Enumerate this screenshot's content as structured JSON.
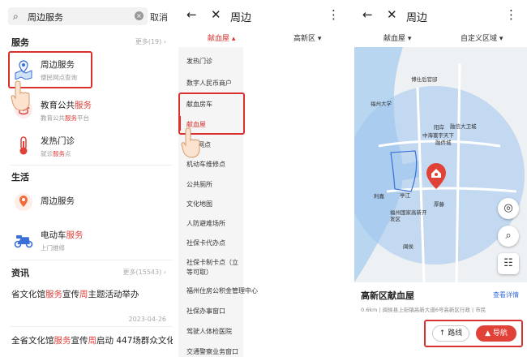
{
  "panel1": {
    "search_value": "周边服务",
    "clear_icon": "clear-icon",
    "cancel_label": "取消",
    "services_section": {
      "title": "服务",
      "more": "更多(19)"
    },
    "services": [
      {
        "title": "周边服务",
        "sub": "便民网点查询",
        "icon": "map-pin-icon"
      },
      {
        "title_plain": "教育公共",
        "title_hl": "服务",
        "sub_plain": "教育公共",
        "sub_hl": "服务",
        "sub_tail": "平台",
        "icon": "education-icon"
      },
      {
        "title": "发热门诊",
        "sub_plain": "就诊",
        "sub_hl": "服务",
        "sub_tail": "点",
        "icon": "thermometer-icon"
      }
    ],
    "life_section": {
      "title": "生活"
    },
    "life": [
      {
        "title": "周边服务",
        "icon": "map-pin-icon"
      },
      {
        "title_plain": "电动车",
        "title_hl": "服务",
        "sub": "上门维修",
        "icon": "scooter-icon"
      }
    ],
    "news_section": {
      "title": "资讯",
      "more": "更多(15543)"
    },
    "news": [
      {
        "a": "省文化馆",
        "b": "服务",
        "c": "宣传",
        "d": "周",
        "e": "主题活动举办",
        "date": "2023-04-26"
      },
      {
        "a": "全省文化馆",
        "b": "服务",
        "c": "宣传",
        "d": "周",
        "e": "启动 447场群众文化"
      }
    ]
  },
  "panel2": {
    "title": "周边",
    "filter_left": "献血屋",
    "filter_right": "高新区",
    "menu": [
      "发热门诊",
      "数字人民币商户",
      "献血房车",
      "献血屋",
      "区网点",
      "机动车维修点",
      "公共厕所",
      "文化地图",
      "人防避难场所",
      "社保卡代办点",
      "社保卡制卡点（立等可取）",
      "福州住房公积金管理中心",
      "社保办事窗口",
      "驾驶人体检医院",
      "交通警察业务窗口"
    ],
    "selected_index": 3
  },
  "panel3": {
    "title": "周边",
    "filter_left": "献血屋",
    "filter_right": "自定义区域",
    "map_labels": [
      "博仕后官邸",
      "福州大学",
      "融信大卫城",
      "阳岸",
      "融侨城",
      "中海寰宇天下",
      "亭江",
      "利嘉",
      "厚藤",
      "福州国家高新开发区",
      "闽侯"
    ],
    "place_name": "高新区献血屋",
    "detail_link": "查看详情",
    "address": "0.6km | 闽侯县上街镇高新大道6号高新区行政 | 市民",
    "route_label": "路线",
    "nav_label": "导航",
    "colors": {
      "accent": "#e04238",
      "map_water": "#b8d6f0",
      "map_land": "#eef1f4"
    }
  }
}
